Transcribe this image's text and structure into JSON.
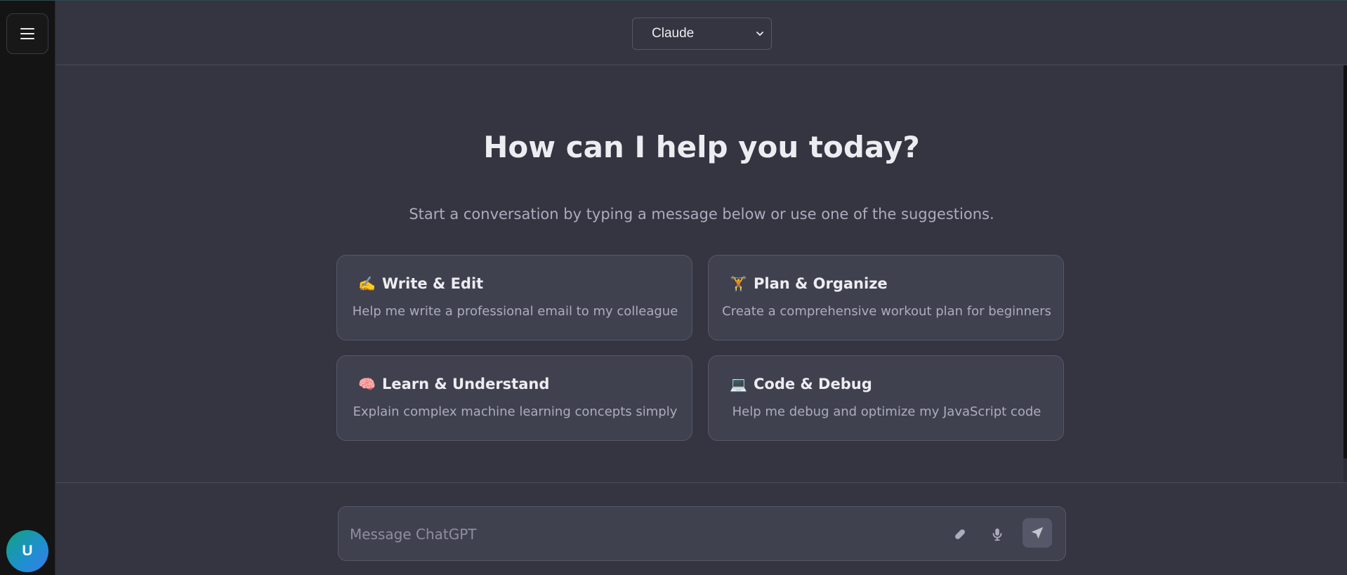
{
  "rail": {
    "menu_icon": "hamburger-icon",
    "avatar_initial": "U"
  },
  "header": {
    "model_select": {
      "selected": "Claude",
      "icon": "chevron-down-icon"
    }
  },
  "hero": {
    "title": "How can I help you today?",
    "subtitle": "Start a conversation by typing a message below or use one of the suggestions."
  },
  "suggestions": [
    {
      "emoji": "✍️",
      "title": "Write & Edit",
      "description": "Help me write a professional email to my colleague"
    },
    {
      "emoji": "🏋️",
      "title": "Plan & Organize",
      "description": "Create a comprehensive workout plan for beginners"
    },
    {
      "emoji": "🧠",
      "title": "Learn & Understand",
      "description": "Explain complex machine learning concepts simply"
    },
    {
      "emoji": "💻",
      "title": "Code & Debug",
      "description": "Help me debug and optimize my JavaScript code"
    }
  ],
  "composer": {
    "placeholder": "Message ChatGPT",
    "value": "",
    "attach_icon": "paperclip-icon",
    "mic_icon": "microphone-icon",
    "send_icon": "send-icon"
  },
  "colors": {
    "background": "#343541",
    "rail": "#141414",
    "card": "#40414f",
    "border": "#565869",
    "avatar_gradient_start": "#10a37f",
    "avatar_gradient_end": "#3b7de8"
  }
}
